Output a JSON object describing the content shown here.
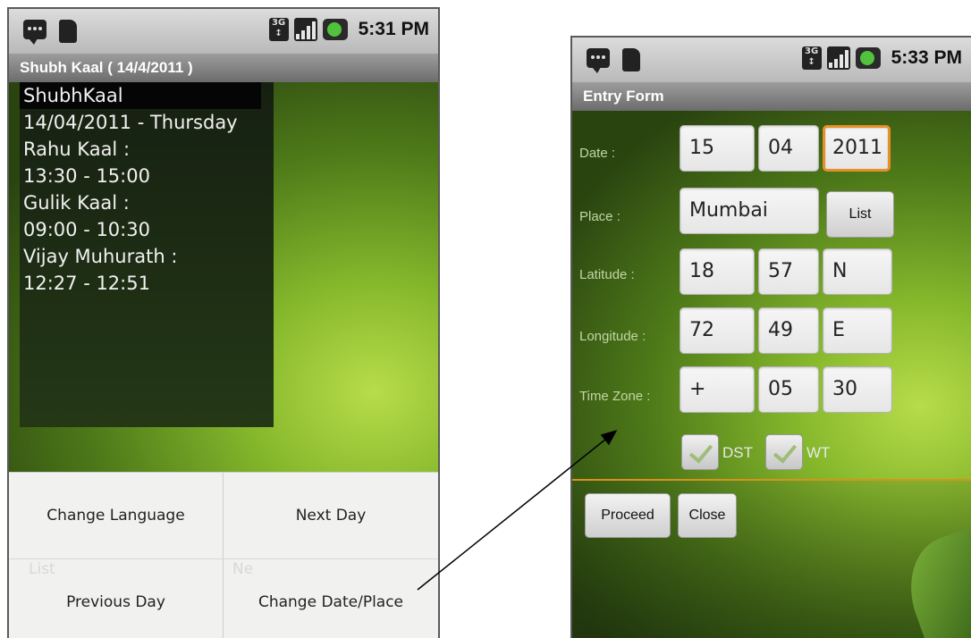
{
  "left_phone": {
    "status_time": "5:31 PM",
    "title": "Shubh Kaal ( 14/4/2011 )",
    "info_lines": [
      "ShubhKaal",
      "14/04/2011 - Thursday",
      "",
      "Rahu Kaal :",
      "13:30 - 15:00",
      "",
      "Gulik Kaal :",
      "09:00 - 10:30",
      "",
      "Vijay Muhurath :",
      "12:27 - 12:51"
    ],
    "menu": {
      "change_language": "Change Language",
      "next_day": "Next Day",
      "previous_day": "Previous Day",
      "change_date_place": "Change Date/Place"
    },
    "ghost_text": {
      "list": "List",
      "ne": "Ne"
    }
  },
  "right_phone": {
    "status_time": "5:33 PM",
    "title": "Entry Form",
    "labels": {
      "date": "Date :",
      "place": "Place :",
      "latitude": "Latitude :",
      "longitude": "Longitude :",
      "timezone": "Time Zone :"
    },
    "fields": {
      "date_day": "15",
      "date_month": "04",
      "date_year": "2011",
      "place": "Mumbai",
      "lat_deg": "18",
      "lat_min": "57",
      "lat_dir": "N",
      "lon_deg": "72",
      "lon_min": "49",
      "lon_dir": "E",
      "tz_sign": "+",
      "tz_hours": "05",
      "tz_minutes": "30"
    },
    "buttons": {
      "list": "List",
      "proceed": "Proceed",
      "close": "Close"
    },
    "checkboxes": {
      "dst_label": "DST",
      "wt_label": "WT"
    }
  },
  "icons": [
    "talk-icon",
    "sd-card-icon",
    "3g-icon",
    "signal-icon",
    "battery-icon"
  ],
  "colors": {
    "accent_focus": "#e89028",
    "title_bar": "#6c6c6c",
    "background_green": "#4e7a19"
  }
}
